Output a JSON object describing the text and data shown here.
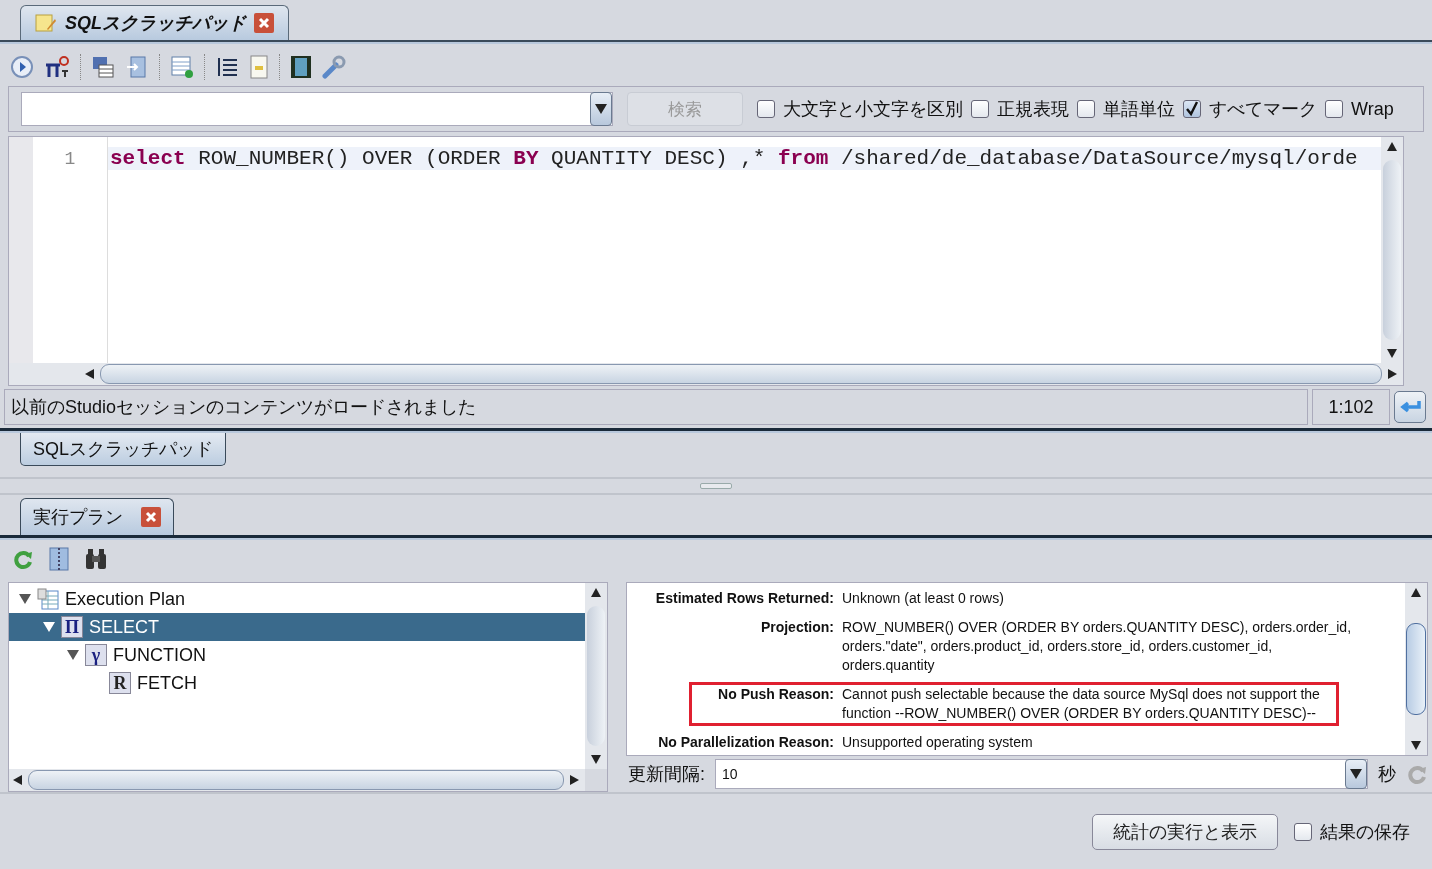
{
  "editor_tab": {
    "label": "SQLスクラッチパッド",
    "selected": true
  },
  "search": {
    "button": "検索",
    "options": [
      {
        "label": "大文字と小文字を区別",
        "checked": false
      },
      {
        "label": "正規表現",
        "checked": false
      },
      {
        "label": "単語単位",
        "checked": false
      },
      {
        "label": "すべてマーク",
        "checked": true
      },
      {
        "label": "Wrap",
        "checked": false
      }
    ]
  },
  "editor": {
    "line_number": "1",
    "tokens": [
      {
        "kind": "keyword",
        "text": "select"
      },
      {
        "kind": "plain",
        "text": " ROW_NUMBER() OVER (ORDER "
      },
      {
        "kind": "keyword",
        "text": "BY"
      },
      {
        "kind": "plain",
        "text": " QUANTITY DESC) ,* "
      },
      {
        "kind": "keyword",
        "text": "from"
      },
      {
        "kind": "plain",
        "text": " /shared/de_database/DataSource/mysql/orde"
      }
    ]
  },
  "status_bar": {
    "message": "以前のStudioセッションのコンテンツがロードされました",
    "position": "1:102"
  },
  "bottom_tabs": [
    {
      "label": "SQLスクラッチパッド",
      "selected": false
    }
  ],
  "plan_tab": {
    "label": "実行プラン",
    "selected": true
  },
  "tree": [
    {
      "label": "Execution Plan",
      "kind": "plan",
      "expanded": true,
      "selected": false,
      "children": [
        {
          "label": "SELECT",
          "kind": "select",
          "symbol": "Π",
          "expanded": true,
          "selected": true,
          "children": [
            {
              "label": "FUNCTION",
              "kind": "function",
              "symbol": "γ",
              "expanded": true,
              "selected": false,
              "children": [
                {
                  "label": "FETCH",
                  "kind": "fetch",
                  "symbol": "R",
                  "selected": false
                }
              ]
            }
          ]
        }
      ]
    }
  ],
  "details": [
    {
      "label": "Estimated Rows Returned:",
      "lines": [
        "Unknown (at least 0 rows)"
      ],
      "highlighted": false
    },
    {
      "label": "Projection:",
      "lines": [
        "ROW_NUMBER() OVER (ORDER BY orders.QUANTITY DESC), orders.order_id,",
        "orders.\"date\", orders.product_id, orders.store_id, orders.customer_id,",
        "orders.quantity"
      ],
      "highlighted": false
    },
    {
      "label": "No Push Reason:",
      "lines": [
        "Cannot push selectable because the data source MySql does not support the",
        "function --ROW_NUMBER() OVER (ORDER BY orders.QUANTITY DESC)--"
      ],
      "highlighted": true
    },
    {
      "label": "No Parallelization Reason:",
      "lines": [
        "Unsupported operating system"
      ],
      "highlighted": false
    }
  ],
  "refresh": {
    "label": "更新間隔:",
    "value": "10",
    "unit": "秒"
  },
  "run_button": "統計の実行と表示",
  "save_results": {
    "label": "結果の保存",
    "checked": false
  }
}
